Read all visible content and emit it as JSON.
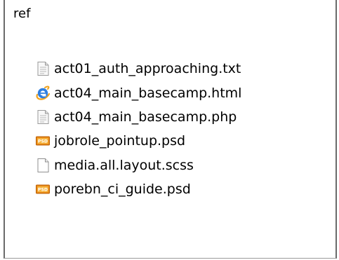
{
  "folder": {
    "name": "ref"
  },
  "files": [
    {
      "name": "act01_auth_approaching.txt",
      "icon": "text-file-icon"
    },
    {
      "name": "act04_main_basecamp.html",
      "icon": "internet-explorer-file-icon"
    },
    {
      "name": "act04_main_basecamp.php",
      "icon": "text-file-icon"
    },
    {
      "name": "jobrole_pointup.psd",
      "icon": "photoshop-psd-file-icon"
    },
    {
      "name": "media.all.layout.scss",
      "icon": "blank-file-icon"
    },
    {
      "name": "porebn_ci_guide.psd",
      "icon": "photoshop-psd-file-icon"
    }
  ],
  "colors": {
    "frame_border": "#6a6a6a",
    "ie_blue": "#2f7fe0",
    "ie_orange": "#f0a21d",
    "psd_orange": "#e98a16"
  }
}
